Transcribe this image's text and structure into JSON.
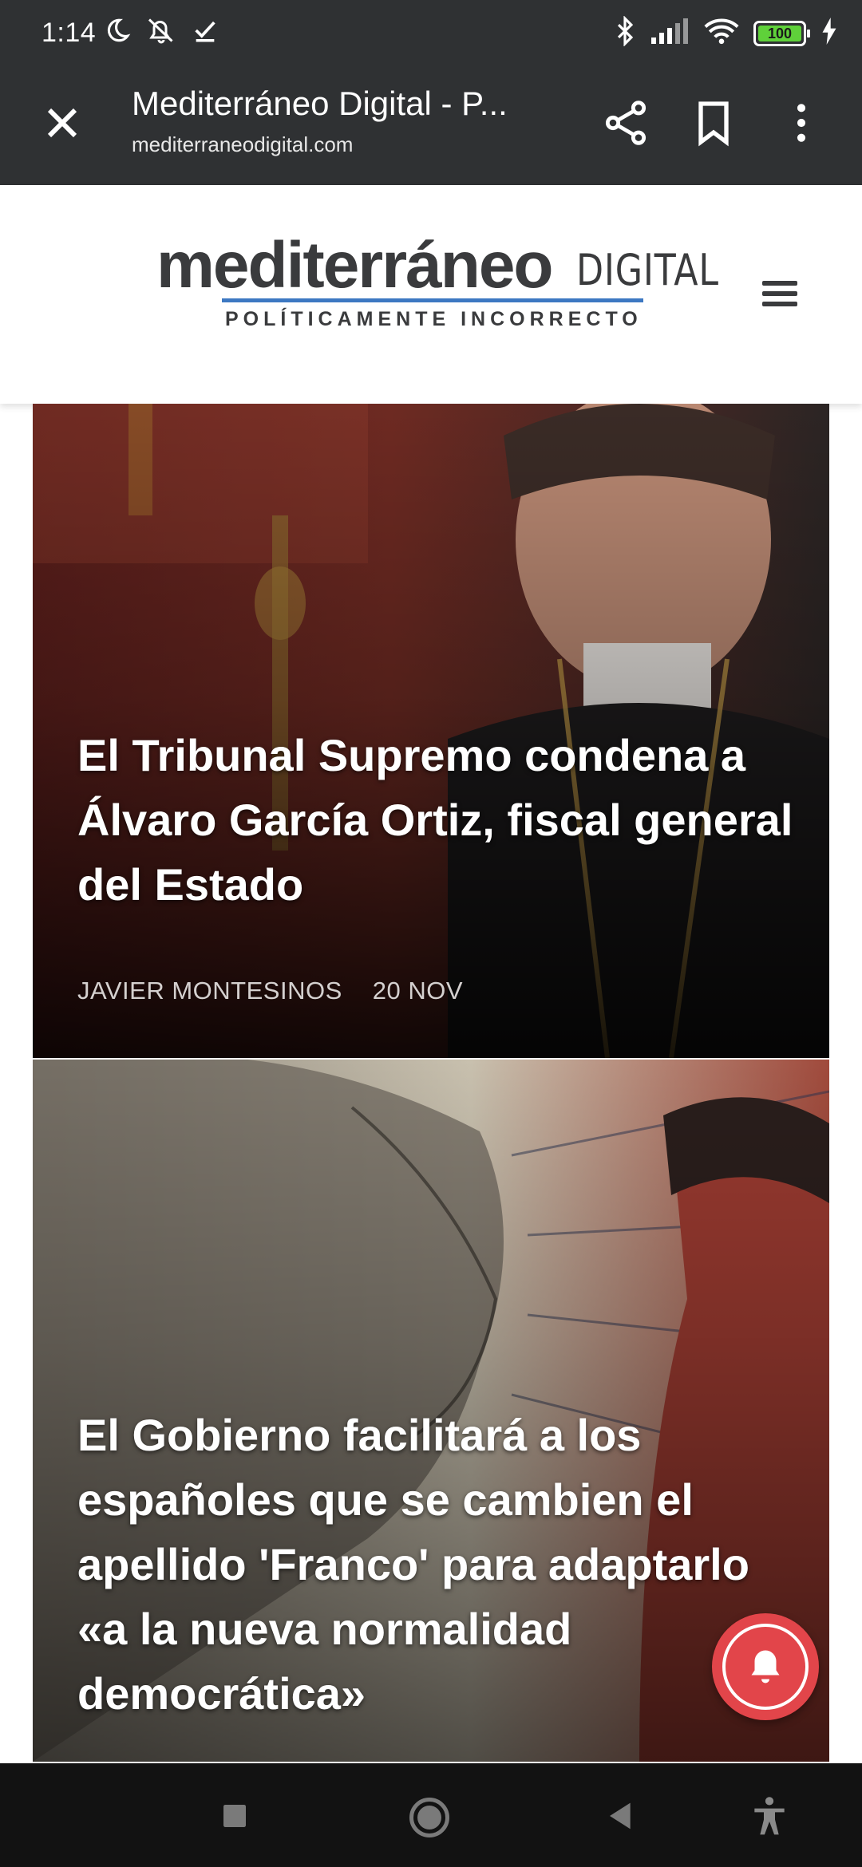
{
  "status_bar": {
    "time": "1:14",
    "battery": "100",
    "left_icons": [
      "moon-icon",
      "notifications-off-icon",
      "check-icon"
    ],
    "right_icons": [
      "bluetooth-icon",
      "signal-icon",
      "wifi-icon",
      "battery-icon",
      "charging-icon"
    ]
  },
  "browser_toolbar": {
    "title": "Mediterráneo Digital - P...",
    "url": "mediterraneodigital.com",
    "icons": [
      "close-icon",
      "share-icon",
      "bookmark-icon",
      "more-vert-icon"
    ]
  },
  "site_header": {
    "logo_main": "mediterráneo",
    "logo_suffix": "DIGITAL",
    "tagline": "POLÍTICAMENTE INCORRECTO",
    "menu_icon": "hamburger-menu-icon"
  },
  "articles": [
    {
      "headline": "El Tribunal Supremo condena a Álvaro García Ortiz, fiscal general del Estado",
      "author": "JAVIER MONTESINOS",
      "date": "20 NOV"
    },
    {
      "headline": "El Gobierno facilitará a los españoles que se cambien el apellido 'Franco' para adaptarlo «a la nueva normalidad democrática»"
    }
  ],
  "notification_button": {
    "icon": "bell-icon",
    "color": "#e2454a"
  },
  "nav_bar": {
    "icons": [
      "recents-square-icon",
      "home-circle-icon",
      "back-triangle-icon",
      "accessibility-icon"
    ]
  },
  "colors": {
    "toolbar": "#2f3133",
    "logo_text": "#3a3b3d",
    "logo_underline": "#3d78c2"
  }
}
